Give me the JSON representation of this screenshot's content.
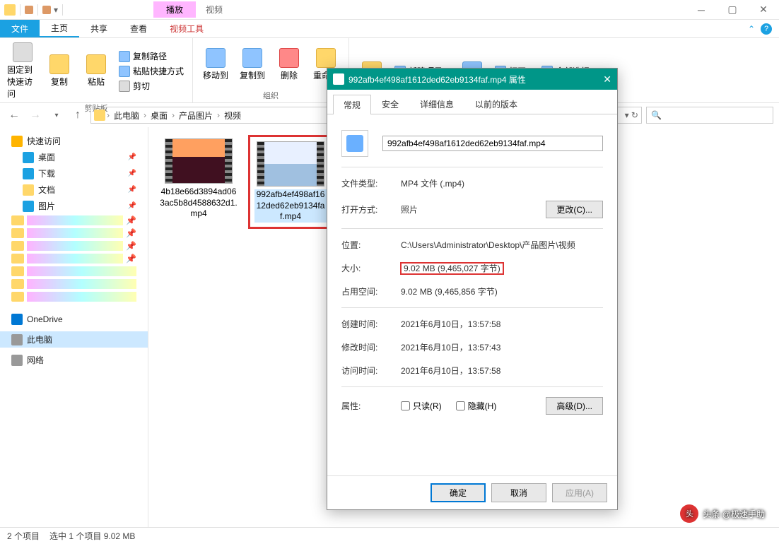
{
  "titlebar": {
    "context_tab": "播放",
    "context_label": "视频"
  },
  "ribbon_tabs": {
    "file": "文件",
    "home": "主页",
    "share": "共享",
    "view": "查看",
    "video_tools": "视频工具"
  },
  "ribbon": {
    "pin": "固定到快速访问",
    "copy": "复制",
    "paste": "粘贴",
    "copy_path": "复制路径",
    "paste_shortcut": "粘贴快捷方式",
    "cut": "剪切",
    "clipboard_group": "剪贴板",
    "move_to": "移动到",
    "copy_to": "复制到",
    "delete": "删除",
    "rename": "重命名",
    "organize_group": "组织",
    "new_item": "新建项目",
    "open": "打开",
    "select_all": "全部选择"
  },
  "breadcrumb": {
    "this_pc": "此电脑",
    "desktop": "桌面",
    "folder1": "产品图片",
    "folder2": "视频"
  },
  "sidebar": {
    "quick_access": "快速访问",
    "desktop": "桌面",
    "downloads": "下载",
    "documents": "文档",
    "pictures": "图片",
    "onedrive": "OneDrive",
    "this_pc": "此电脑",
    "network": "网络"
  },
  "files": {
    "f1": "4b18e66d3894ad063ac5b8d4588632d1.mp4",
    "f2": "992afb4ef498af1612ded62eb9134faf.mp4"
  },
  "statusbar": {
    "count": "2 个项目",
    "selected": "选中 1 个项目  9.02 MB"
  },
  "dialog": {
    "title": "992afb4ef498af1612ded62eb9134faf.mp4 属性",
    "tabs": {
      "general": "常规",
      "security": "安全",
      "details": "详细信息",
      "previous": "以前的版本"
    },
    "filename": "992afb4ef498af1612ded62eb9134faf.mp4",
    "type_label": "文件类型:",
    "type_value": "MP4 文件 (.mp4)",
    "opens_label": "打开方式:",
    "opens_value": "照片",
    "change_btn": "更改(C)...",
    "location_label": "位置:",
    "location_value": "C:\\Users\\Administrator\\Desktop\\产品图片\\视频",
    "size_label": "大小:",
    "size_value": "9.02 MB (9,465,027 字节)",
    "disk_label": "占用空间:",
    "disk_value": "9.02 MB (9,465,856 字节)",
    "created_label": "创建时间:",
    "created_value": "2021年6月10日，13:57:58",
    "modified_label": "修改时间:",
    "modified_value": "2021年6月10日，13:57:43",
    "accessed_label": "访问时间:",
    "accessed_value": "2021年6月10日，13:57:58",
    "attrs_label": "属性:",
    "readonly": "只读(R)",
    "hidden": "隐藏(H)",
    "advanced": "高级(D)...",
    "ok": "确定",
    "cancel": "取消",
    "apply": "应用(A)"
  },
  "watermark": "头条 @极速手助"
}
